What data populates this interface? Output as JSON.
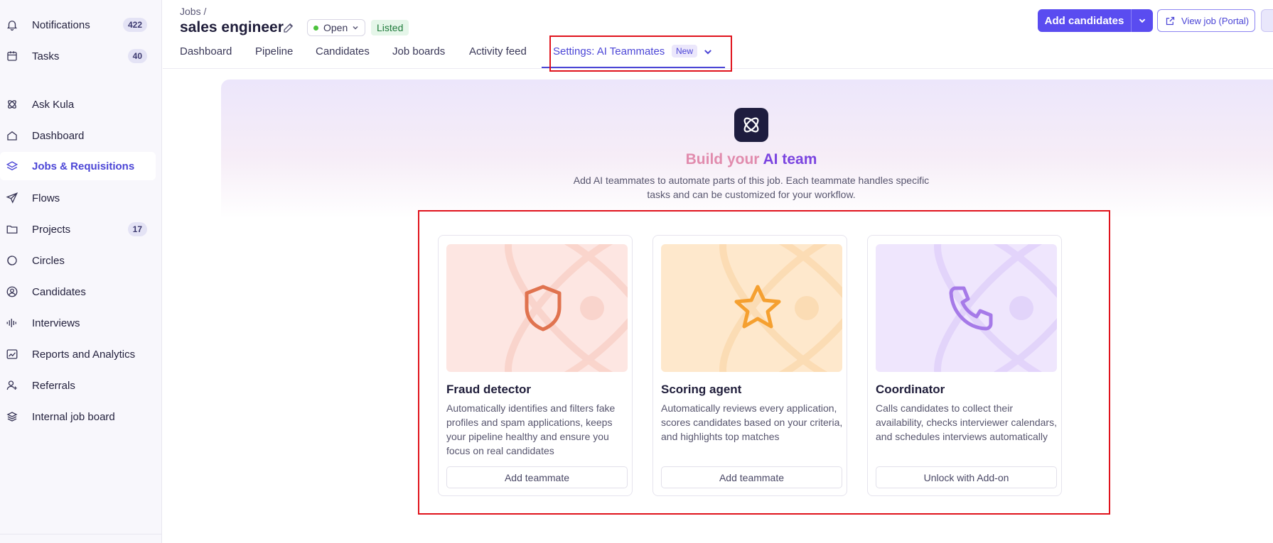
{
  "sidebar": {
    "items": [
      {
        "label": "Notifications",
        "icon": "bell-icon",
        "count": "422"
      },
      {
        "label": "Tasks",
        "icon": "calendar-icon",
        "count": "40"
      },
      {
        "label": "Ask Kula",
        "icon": "kula-icon"
      },
      {
        "label": "Dashboard",
        "icon": "home-icon"
      },
      {
        "label": "Jobs & Requisitions",
        "icon": "layers-icon",
        "active": true
      },
      {
        "label": "Flows",
        "icon": "send-icon"
      },
      {
        "label": "Projects",
        "icon": "folder-icon",
        "count": "17"
      },
      {
        "label": "Circles",
        "icon": "circle-icon"
      },
      {
        "label": "Candidates",
        "icon": "user-circle-icon"
      },
      {
        "label": "Interviews",
        "icon": "audio-wave-icon"
      },
      {
        "label": "Reports and Analytics",
        "icon": "chart-icon"
      },
      {
        "label": "Referrals",
        "icon": "user-plus-icon"
      },
      {
        "label": "Internal job board",
        "icon": "stack-icon"
      }
    ]
  },
  "header": {
    "breadcrumb": "Jobs /",
    "title": "sales engineer",
    "status": "Open",
    "listed": "Listed",
    "add_candidates": "Add candidates",
    "view_job": "View job (Portal)"
  },
  "tabs": [
    {
      "label": "Dashboard"
    },
    {
      "label": "Pipeline"
    },
    {
      "label": "Candidates"
    },
    {
      "label": "Job boards"
    },
    {
      "label": "Activity feed"
    },
    {
      "label": "Settings: AI Teammates",
      "active": true,
      "badge": "New"
    }
  ],
  "hero": {
    "title_part1": "Build your ",
    "title_part2": "AI team",
    "description": "Add AI teammates to automate parts of this job. Each teammate handles specific tasks and can be customized for your workflow."
  },
  "cards": [
    {
      "title": "Fraud detector",
      "icon": "shield-icon",
      "description": "Automatically identifies and filters fake profiles and spam applications, keeps your pipeline healthy and ensure you focus on real candidates",
      "button": "Add teammate",
      "accent": "#e0734f",
      "art_bg": "#fde6e2"
    },
    {
      "title": "Scoring agent",
      "icon": "star-icon",
      "description": "Automatically reviews every application, scores candidates based on your criteria, and highlights top matches",
      "button": "Add teammate",
      "accent": "#f5a030",
      "art_bg": "#fee8cc"
    },
    {
      "title": "Coordinator",
      "icon": "phone-icon",
      "description": "Calls candidates to collect their availability, checks interviewer calendars, and schedules interviews automatically",
      "button": "Unlock with Add-on",
      "accent": "#a67ae8",
      "art_bg": "#efe6fd"
    }
  ],
  "colors": {
    "brand": "#5a4cf0",
    "annotation": "#e0131c"
  }
}
